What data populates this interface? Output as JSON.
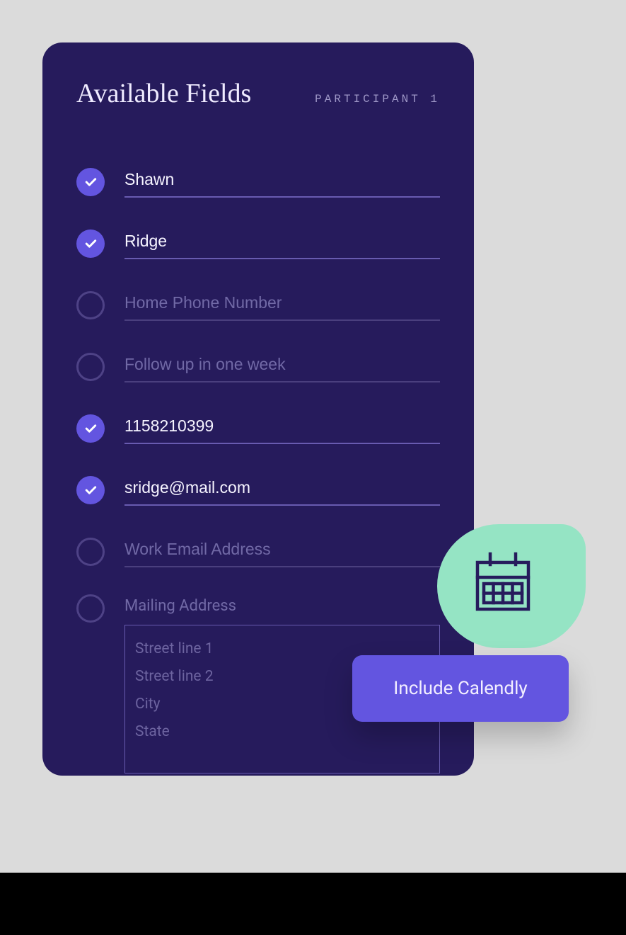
{
  "header": {
    "title": "Available Fields",
    "participant_label": "PARTICIPANT 1"
  },
  "fields": [
    {
      "checked": true,
      "value": "Shawn",
      "placeholder": ""
    },
    {
      "checked": true,
      "value": "Ridge",
      "placeholder": ""
    },
    {
      "checked": false,
      "value": "",
      "placeholder": "Home Phone Number"
    },
    {
      "checked": false,
      "value": "",
      "placeholder": "Follow up in one week"
    },
    {
      "checked": true,
      "value": "1158210399",
      "placeholder": ""
    },
    {
      "checked": true,
      "value": "sridge@mail.com",
      "placeholder": ""
    },
    {
      "checked": false,
      "value": "",
      "placeholder": "Work Email Address"
    }
  ],
  "mailing": {
    "label": "Mailing Address",
    "lines": [
      "Street line 1",
      "Street line 2",
      "City",
      "State"
    ]
  },
  "calendly": {
    "label": "Include Calendly"
  }
}
